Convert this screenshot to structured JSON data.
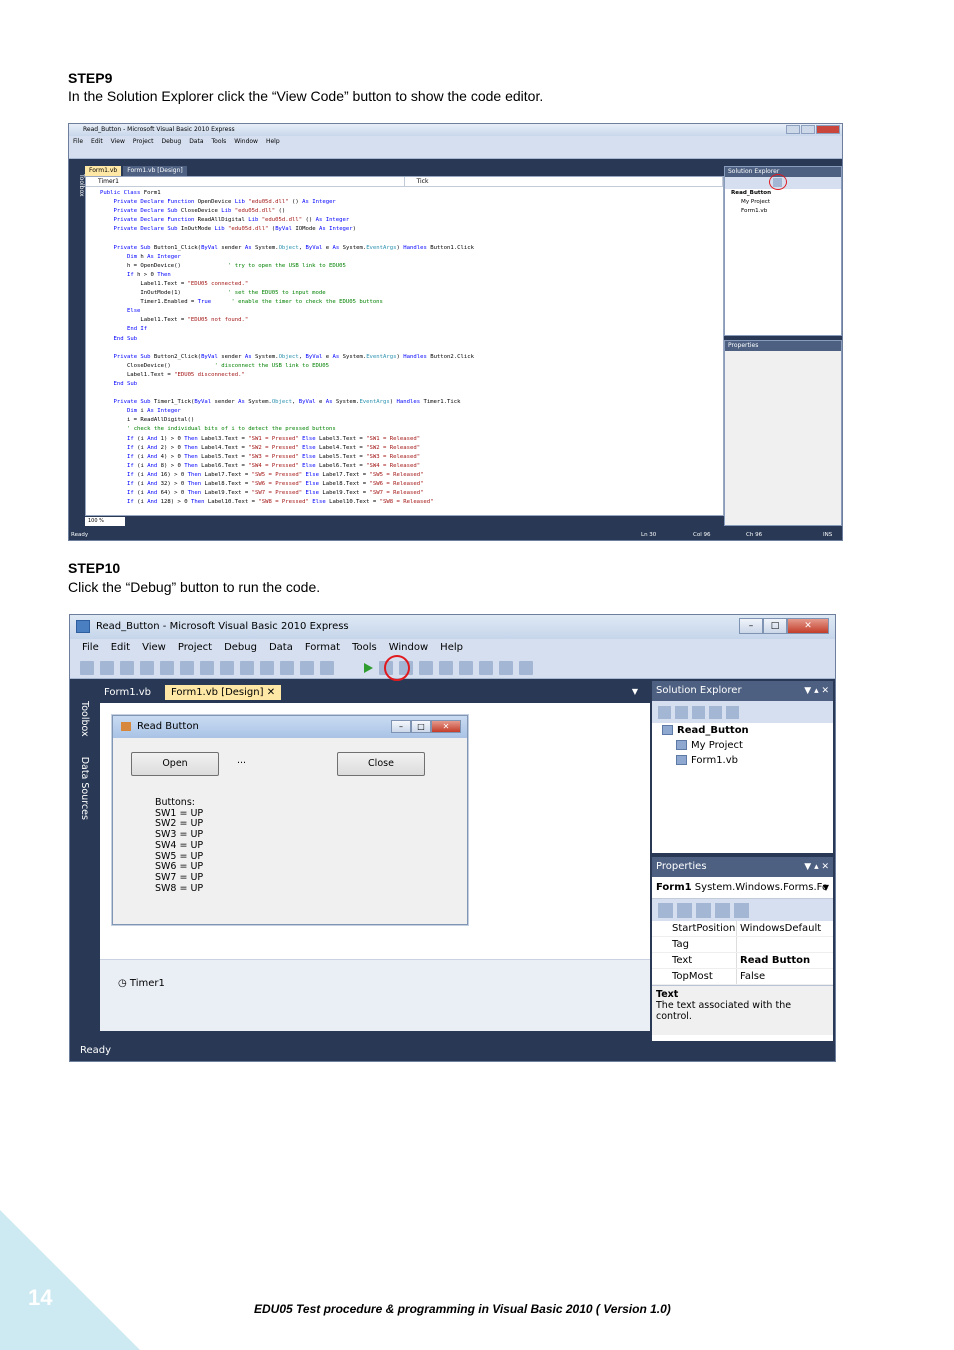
{
  "step9": {
    "title": "STEP9",
    "text": "In the Solution Explorer click the “View Code” button to show the code editor."
  },
  "step10": {
    "title": "STEP10",
    "text": "Click the “Debug” button to run the code."
  },
  "shot1": {
    "window_title": "Read_Button - Microsoft Visual Basic 2010 Express",
    "menu": [
      "File",
      "Edit",
      "View",
      "Project",
      "Debug",
      "Data",
      "Tools",
      "Window",
      "Help"
    ],
    "toolbox": "Toolbox",
    "tabs": [
      "Form1.vb",
      "Form1.vb [Design]"
    ],
    "combo_left": "Timer1",
    "combo_right": "Tick",
    "zoom": "100 %",
    "solution_explorer": "Solution Explorer",
    "project": "Read_Button",
    "items": [
      "My Project",
      "Form1.vb"
    ],
    "properties": "Properties",
    "status": {
      "ready": "Ready",
      "ln": "Ln 30",
      "col": "Col 96",
      "ch": "Ch 96",
      "ins": "INS"
    }
  },
  "shot2": {
    "window_title": "Read_Button - Microsoft Visual Basic 2010 Express",
    "menu": [
      "File",
      "Edit",
      "View",
      "Project",
      "Debug",
      "Data",
      "Format",
      "Tools",
      "Window",
      "Help"
    ],
    "toolbox": "Toolbox",
    "data_sources": "Data Sources",
    "tabs": [
      "Form1.vb",
      "Form1.vb [Design]"
    ],
    "form": {
      "title": "Read Button",
      "open": "Open",
      "close": "Close",
      "dots": "...",
      "labels": [
        "Buttons:",
        "SW1 = UP",
        "SW2 = UP",
        "SW3 = UP",
        "SW4 = UP",
        "SW5 = UP",
        "SW6 = UP",
        "SW7 = UP",
        "SW8 = UP"
      ]
    },
    "tray": "Timer1",
    "solution_explorer": "Solution Explorer",
    "project": "Read_Button",
    "items": [
      "My Project",
      "Form1.vb"
    ],
    "properties": "Properties",
    "prop_object": "Form1",
    "prop_type": "System.Windows.Forms.Fo",
    "prop_rows": [
      {
        "k": "StartPosition",
        "v": "WindowsDefault"
      },
      {
        "k": "Tag",
        "v": ""
      },
      {
        "k": "Text",
        "v": "Read Button"
      },
      {
        "k": "TopMost",
        "v": "False"
      }
    ],
    "desc_title": "Text",
    "desc_text": "The text associated with the control.",
    "status": "Ready"
  },
  "footer": "EDU05 Test procedure & programming in Visual Basic 2010 ( Version 1.0)",
  "page_number": "14",
  "colors": {
    "highlight_circle": "#e0191f",
    "corner": "#cde9f2"
  }
}
